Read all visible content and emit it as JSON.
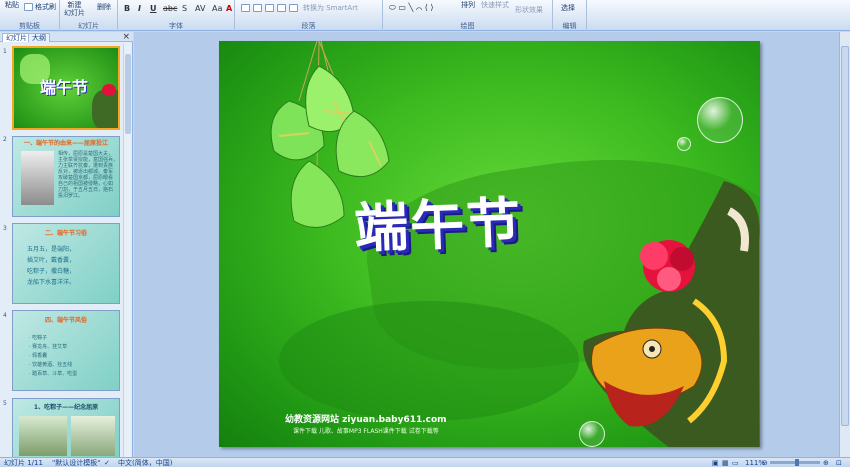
{
  "ribbon": {
    "groups": {
      "clipboard": {
        "label": "剪贴板",
        "paste": "粘贴",
        "format_painter": "格式刷"
      },
      "slides": {
        "label": "幻灯片",
        "new_slide": "新建\n幻灯片",
        "delete": "删除"
      },
      "font": {
        "label": "字体"
      },
      "paragraph": {
        "label": "段落",
        "convert": "转换为 SmartArt"
      },
      "drawing": {
        "label": "绘图",
        "arrange": "排列",
        "quick_styles": "快速样式",
        "shape_effects": "形状效果"
      },
      "editing": {
        "label": "编辑",
        "select": "选择"
      }
    }
  },
  "left_pane": {
    "tabs": [
      "幻灯片",
      "大纲"
    ],
    "close": "×",
    "thumbs": [
      {
        "num": "1",
        "title": "端午节"
      },
      {
        "num": "2",
        "title": "一、端午节的由来——屈原投江",
        "lines": [
          "相传，屈原是楚国大夫，",
          "主张举贤授能，富国强兵，",
          "力主联齐抗秦，遭到贵族",
          "反对，被逐出都城。秦军",
          "攻破楚国京都，屈原眼看",
          "自己的祖国被侵略，心如",
          "刀割，于五月五日，抱石",
          "投汨罗江。"
        ]
      },
      {
        "num": "3",
        "title": "二、端午节习俗",
        "lines": [
          "五月五，是端阳，",
          "插艾叶，戴香囊，",
          "吃粽子，撒白糖，",
          "龙船下水喜洋洋。"
        ]
      },
      {
        "num": "4",
        "title": "四、端午节风俗",
        "lines": [
          "· 吃粽子",
          "· 赛龙舟、挂艾草",
          "· 佩香囊",
          "· 饮雄黄酒、拴五线",
          "· 踏百草、斗草、吃蛋"
        ]
      },
      {
        "num": "5",
        "title": "1、吃粽子——纪念屈原"
      }
    ]
  },
  "slide": {
    "title": "端午节",
    "footer_site": "幼教资源网站  ziyuan.baby611.com",
    "footer_sub": "课件下载   儿歌、故事MP3   FLASH课件下载   试卷下载等"
  },
  "statusbar": {
    "slide_pos": "幻灯片 1/11",
    "theme": "\"默认设计模板\"",
    "language": "中文(简体，中国)",
    "zoom": "111%"
  },
  "colors": {
    "slide_green": "#3cba1f",
    "title_shadow": "#2a2ab8",
    "ribbon_blue": "#15428b"
  }
}
